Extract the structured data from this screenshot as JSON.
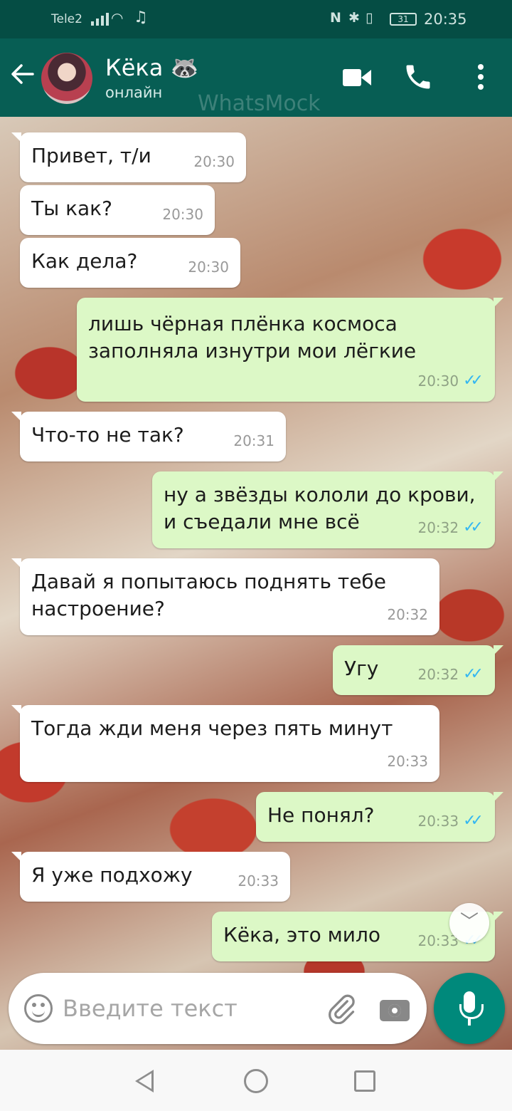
{
  "status_bar": {
    "carrier": "Tele2",
    "battery": "31",
    "time": "20:35"
  },
  "header": {
    "contact_name": "Кёка 🦝",
    "contact_status": "онлайн",
    "watermark": "WhatsMock"
  },
  "messages": [
    {
      "direction": "in",
      "text": "Привет, т/и",
      "time": "20:30"
    },
    {
      "direction": "in",
      "text": "Ты как?",
      "time": "20:30"
    },
    {
      "direction": "in",
      "text": "Как дела?",
      "time": "20:30"
    },
    {
      "direction": "out",
      "text": "лишь чёрная плёнка космоса заполняла изнутри мои лёгкие",
      "time": "20:30",
      "status": "read"
    },
    {
      "direction": "in",
      "text": "Что-то не так?",
      "time": "20:31"
    },
    {
      "direction": "out",
      "text": "ну а звёзды кололи до крови, и съедали мне всё",
      "time": "20:32",
      "status": "read"
    },
    {
      "direction": "in",
      "text": "Давай я попытаюсь поднять тебе настроение?",
      "time": "20:32"
    },
    {
      "direction": "out",
      "text": "Угу",
      "time": "20:32",
      "status": "read"
    },
    {
      "direction": "in",
      "text": "Тогда жди меня через пять минут",
      "time": "20:33"
    },
    {
      "direction": "out",
      "text": "Не понял?",
      "time": "20:33",
      "status": "read"
    },
    {
      "direction": "in",
      "text": "Я уже подхожу",
      "time": "20:33"
    },
    {
      "direction": "out",
      "text": "Кёка, это мило",
      "time": "20:33",
      "status": "read"
    }
  ],
  "input": {
    "placeholder": "Введите текст"
  },
  "colors": {
    "header": "#075e54",
    "outgoing_bubble": "#dcf8c6",
    "incoming_bubble": "#ffffff",
    "read_ticks": "#34b7f1",
    "mic_button": "#00897b"
  }
}
